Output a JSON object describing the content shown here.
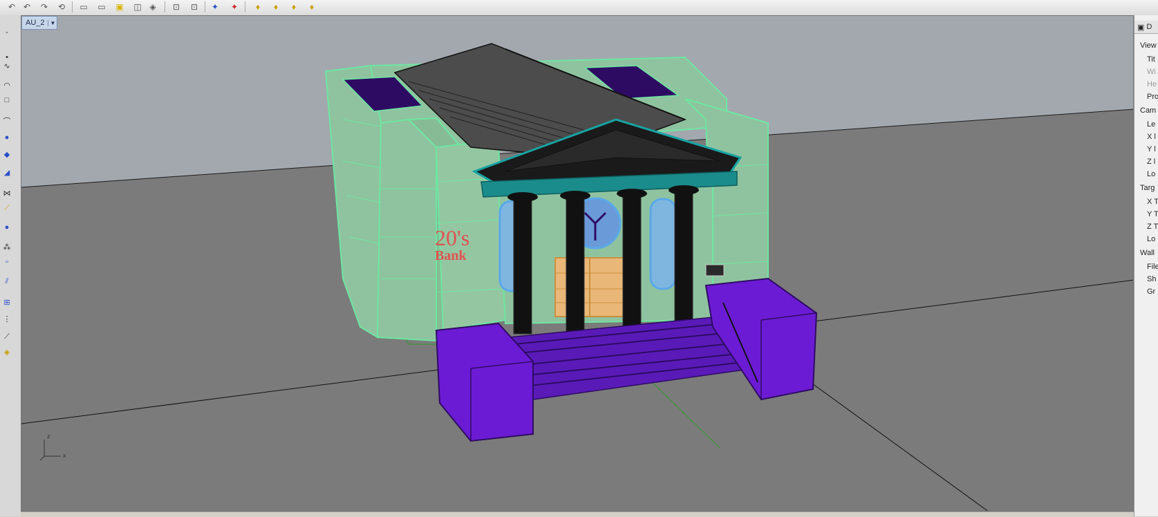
{
  "viewport": {
    "title": "AU_2",
    "axis_z": "z",
    "axis_x": "x",
    "sign": {
      "line1": "20's",
      "line2": "Bank"
    }
  },
  "toolbar": {
    "icons": [
      "undo-icon",
      "undo-icon",
      "redo-icon",
      "rotate-icon",
      "viewport-icon",
      "viewport-icon",
      "layer-icon",
      "frame-icon",
      "frame-icon",
      "snap-icon",
      "snap-icon",
      "render-icon",
      "render-icon",
      "light-icon",
      "light-icon",
      "light-icon",
      "light-icon"
    ]
  },
  "properties_panel": {
    "header": "D",
    "sections": [
      {
        "label": "View",
        "items": [
          {
            "text": "Tit",
            "enabled": true
          },
          {
            "text": "Wi",
            "enabled": false
          },
          {
            "text": "He",
            "enabled": false
          },
          {
            "text": "Pro",
            "enabled": true
          }
        ]
      },
      {
        "label": "Cam",
        "items": [
          {
            "text": "Le",
            "enabled": true
          },
          {
            "text": "X l",
            "enabled": true
          },
          {
            "text": "Y l",
            "enabled": true
          },
          {
            "text": "Z l",
            "enabled": true
          },
          {
            "text": "Lo",
            "enabled": true
          }
        ]
      },
      {
        "label": "Targ",
        "items": [
          {
            "text": "X T",
            "enabled": true
          },
          {
            "text": "Y T",
            "enabled": true
          },
          {
            "text": "Z T",
            "enabled": true
          },
          {
            "text": "Lo",
            "enabled": true
          }
        ]
      },
      {
        "label": "Wall",
        "items": [
          {
            "text": "File",
            "enabled": true
          },
          {
            "text": "Sh",
            "enabled": true
          },
          {
            "text": "Gr",
            "enabled": true
          }
        ]
      }
    ]
  },
  "colors": {
    "viewport_bg": "#a3a8ae",
    "ground": "#7b7b7b",
    "wall_wire": "#6ee6a2",
    "wall_fill": "#8fc39f",
    "purple": "#6c1bd4",
    "roof": "#4c4c4c",
    "column": "#111111",
    "window": "#5aa8e8",
    "door": "#e9b778",
    "sign": "#e25050"
  }
}
